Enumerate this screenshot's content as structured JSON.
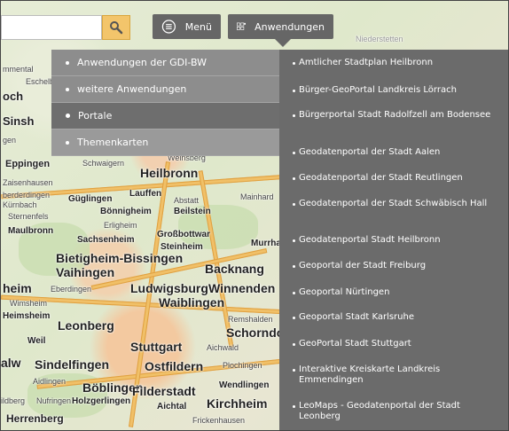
{
  "toolbar": {
    "search_placeholder": "",
    "menu_label": "Menü",
    "apps_label": "Anwendungen"
  },
  "left_menu": [
    {
      "label": "Anwendungen der GDI-BW",
      "active": false
    },
    {
      "label": "weitere Anwendungen",
      "active": false
    },
    {
      "label": "Portale",
      "active": true
    },
    {
      "label": "Themenkarten",
      "active": false
    }
  ],
  "right_menu": [
    "Amtlicher Stadtplan Heilbronn",
    "Bürger-GeoPortal Landkreis Lörrach",
    "Bürgerportal Stadt Radolfzell am Bodensee",
    "Geodatenportal der Stadt Aalen",
    "Geodatenportal der Stadt Reutlingen",
    "Geodatenportal der Stadt Schwäbisch Hall",
    "Geodatenportal Stadt Heilbronn",
    "Geoportal der Stadt Freiburg",
    "Geoportal Nürtingen",
    "Geoportal Stadt Karlsruhe",
    "GeoPortal Stadt Stuttgart",
    "Interaktive Kreiskarte Landkreis Emmendingen",
    "LeoMaps - Geodatenportal der Stadt Leonberg"
  ],
  "map_labels": {
    "heilbronn": "Heilbronn",
    "eppingen": "Eppingen",
    "schwaigern": "Schwaigern",
    "weinsberg": "Weinsberg",
    "guglingen": "Güglingen",
    "lauffen": "Lauffen",
    "abstatt": "Abstatt",
    "bonnigheim": "Bönnigheim",
    "beilstein": "Beilstein",
    "sternenfels": "Sternenfels",
    "erligheim": "Erligheim",
    "maulbronn": "Maulbronn",
    "grossbottwar": "Großbottwar",
    "sachsenheim": "Sachsenheim",
    "steinheim": "Steinheim",
    "murrhardt": "Murrhar",
    "bietigheim": "Bietigheim-Bissingen",
    "vaihingen": "Vaihingen",
    "backnang": "Backnang",
    "ludwigsburg": "Ludwigsburg",
    "winnenden": "Winnenden",
    "eberdingen": "Eberdingen",
    "waiblingen": "Waiblingen",
    "heimsheim": "Heimsheim",
    "leonberg": "Leonberg",
    "remshalden": "Remshalden",
    "schorndorf": "Schorndorf",
    "weil": "Weil",
    "stuttgart": "Stuttgart",
    "aichwald": "Aichwald",
    "sindelfingen": "Sindelfingen",
    "ostfildern": "Ostfildern",
    "plochingen": "Plochingen",
    "aidlingen": "Aidlingen",
    "boblingen": "Böblingen",
    "filderstadt": "Filderstadt",
    "wendlingen": "Wendlingen",
    "nufringen": "Nufringen",
    "holzgerlingen": "Holzgerlingen",
    "aichtal": "Aichtal",
    "kirchheim": "Kirchheim",
    "herrenberg": "Herrenberg",
    "frickenhausen": "Frickenhausen",
    "och": "och",
    "sinsh": "Sinsh",
    "eschelb": "Eschelb",
    "mainhard": "Mainhard",
    "mmental": "mmental",
    "eim": "heim",
    "alw": "alw",
    "ildberg": "ildberg",
    "gen": "gen",
    "zaisenhausen": "Zaisenhausen",
    "oberderdingen": "berderdingen",
    "kurnbach": "Kürnbach",
    "wimsheim": "Wimsheim",
    "niederstetten": "Niederstetten"
  },
  "colors": {
    "menu_button": "#666666",
    "search_button": "#f3c56b",
    "left_menu_bg": "#8d8d8d",
    "left_menu_active": "#6e6e6e",
    "right_menu_bg": "#6b6b6b"
  }
}
